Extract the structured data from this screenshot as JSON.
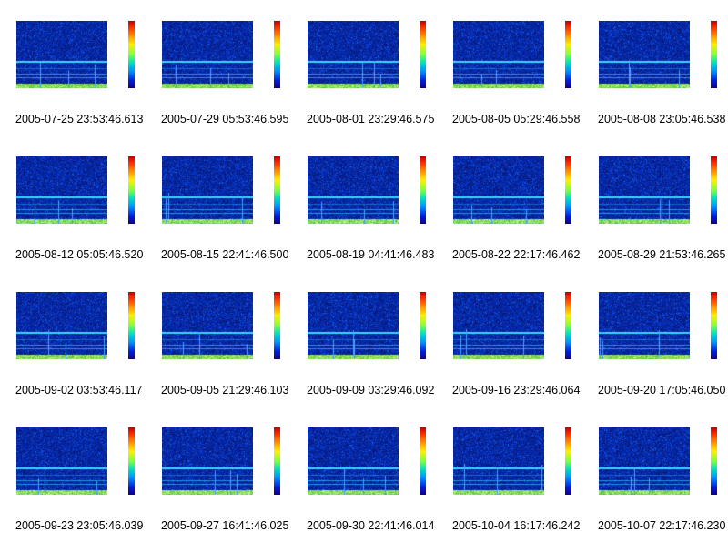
{
  "panels": [
    {
      "caption": "2005-07-25 23:53:46.613"
    },
    {
      "caption": "2005-07-29 05:53:46.595"
    },
    {
      "caption": "2005-08-01 23:29:46.575"
    },
    {
      "caption": "2005-08-05 05:29:46.558"
    },
    {
      "caption": "2005-08-08 23:05:46.538"
    },
    {
      "caption": "2005-08-12 05:05:46.520"
    },
    {
      "caption": "2005-08-15 22:41:46.500"
    },
    {
      "caption": "2005-08-19 04:41:46.483"
    },
    {
      "caption": "2005-08-22 22:17:46.462"
    },
    {
      "caption": "2005-08-29 21:53:46.265"
    },
    {
      "caption": "2005-09-02 03:53:46.117"
    },
    {
      "caption": "2005-09-05 21:29:46.103"
    },
    {
      "caption": "2005-09-09 03:29:46.092"
    },
    {
      "caption": "2005-09-16 23:29:46.064"
    },
    {
      "caption": "2005-09-20 17:05:46.050"
    },
    {
      "caption": "2005-09-23 23:05:46.039"
    },
    {
      "caption": "2005-09-27 16:41:46.025"
    },
    {
      "caption": "2005-09-30 22:41:46.014"
    },
    {
      "caption": "2005-10-04 16:17:46.242"
    },
    {
      "caption": "2005-10-07 22:17:46.230"
    }
  ],
  "colors": {
    "background": "#071a78",
    "band": "#3ad6ff",
    "floor": "#7fe070"
  }
}
